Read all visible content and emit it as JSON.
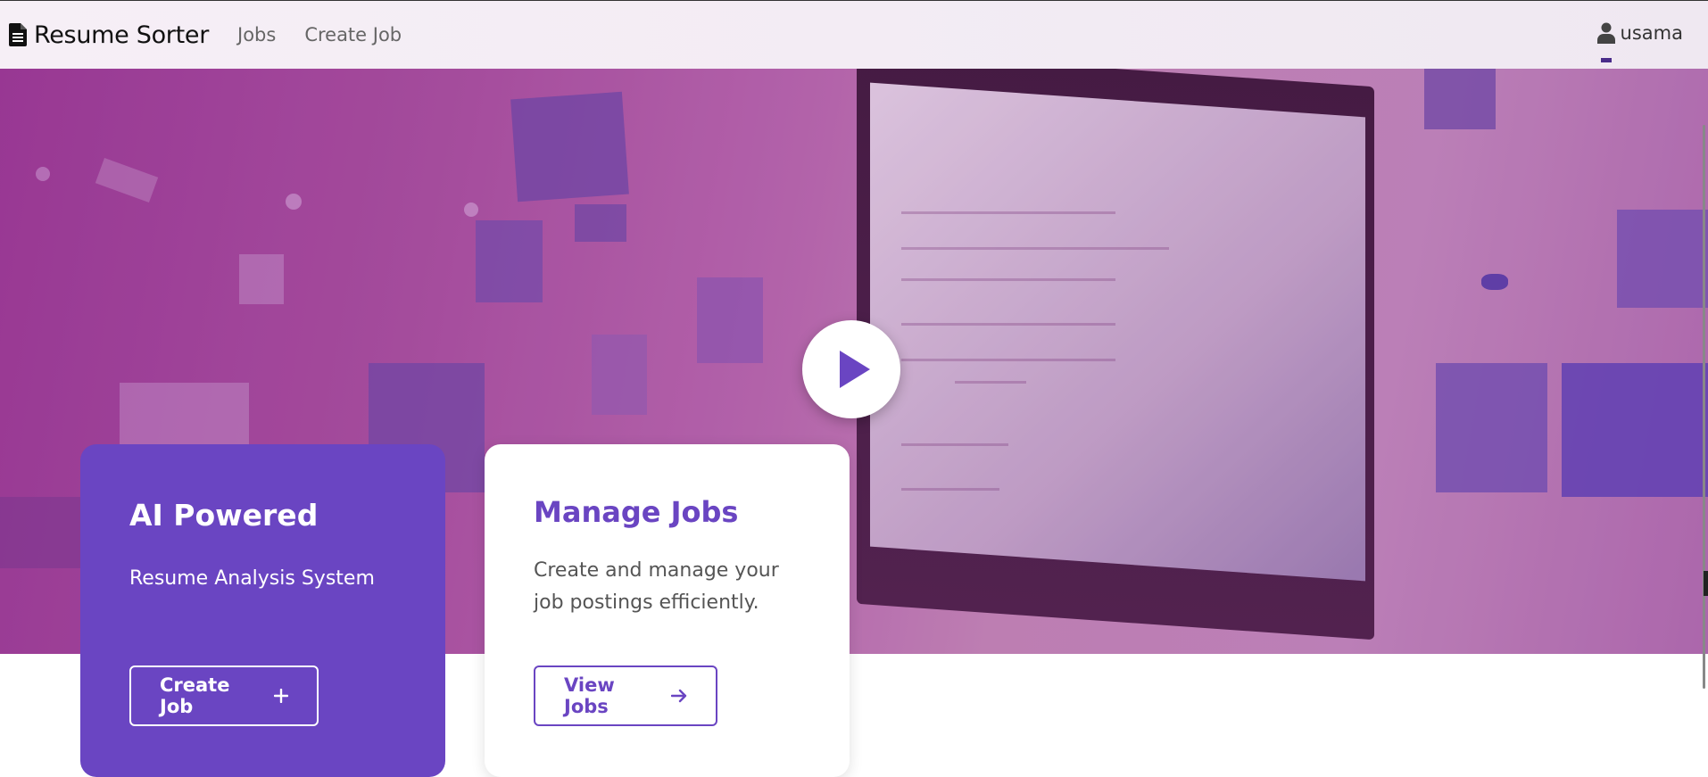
{
  "navbar": {
    "brand_icon": "document-icon",
    "brand": "Resume Sorter",
    "links": [
      "Jobs",
      "Create Job"
    ],
    "user_icon": "user-icon",
    "user_name": "usama"
  },
  "hero": {
    "play_icon": "play-icon",
    "accent_color": "#6a45c2"
  },
  "cards": {
    "ai": {
      "title": "AI Powered",
      "subtitle": "Resume Analysis System",
      "button_label": "Create Job",
      "button_icon": "plus-icon",
      "background": "#6a45c2"
    },
    "jobs": {
      "title": "Manage Jobs",
      "subtitle": "Create and manage your job postings efficiently.",
      "button_label": "View Jobs",
      "button_icon": "arrow-right-icon"
    }
  }
}
